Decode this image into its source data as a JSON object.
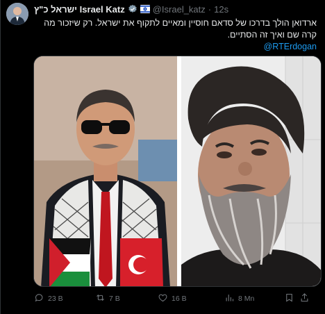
{
  "tweet": {
    "author_name": "ישראל כ\"ץ Israel Katz",
    "handle": "@Israel_katz",
    "separator": "·",
    "time": "12s",
    "text_line1": "ארדואן הולך בדרכו של סדאם חוסיין ומאיים לתקוף את ישראל. רק שיזכור מה קרה",
    "text_line2": "שם ואיך זה הסתיים.",
    "mention": "@RTErdogan",
    "more": "···"
  },
  "actions": {
    "replies": "23 B",
    "reposts": "7 B",
    "likes": "16 B",
    "views": "8 Mn"
  },
  "colors": {
    "background": "#000000",
    "text": "#e7e9ea",
    "secondary": "#71767b",
    "link": "#1d9bf0",
    "verified": "#829aab"
  },
  "icons": [
    "reply-icon",
    "repost-icon",
    "like-icon",
    "views-icon",
    "bookmark-icon",
    "share-icon",
    "verified-badge-icon",
    "israel-flag-icon"
  ]
}
